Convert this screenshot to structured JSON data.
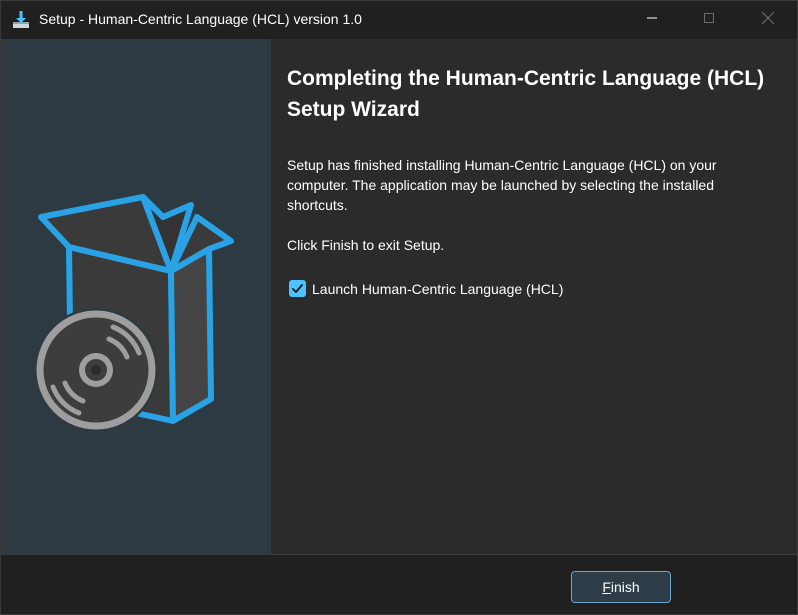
{
  "window": {
    "title": "Setup - Human-Centric Language (HCL) version 1.0",
    "app_icon": "installer-icon",
    "controls": [
      "minimize-icon",
      "maximize-icon",
      "close-icon"
    ]
  },
  "sidebar": {
    "image": "software-box-with-disc-icon"
  },
  "main": {
    "heading": "Completing the Human-Centric Language (HCL) Setup Wizard",
    "paragraph_1": "Setup has finished installing Human-Centric Language (HCL) on your computer. The application may be launched by selecting the installed shortcuts.",
    "paragraph_2": "Click Finish to exit Setup.",
    "launch_checkbox": {
      "label": "Launch Human-Centric Language (HCL)",
      "checked": true
    }
  },
  "footer": {
    "finish_button": {
      "label_underlined": "F",
      "label_rest": "inish"
    }
  },
  "colors": {
    "accent": "#4cc2ff",
    "box_outline": "#29a3e6",
    "sidebar_bg": "#2e3a42",
    "window_bg": "#2b2b2b",
    "titlebar_bg": "#202020"
  }
}
